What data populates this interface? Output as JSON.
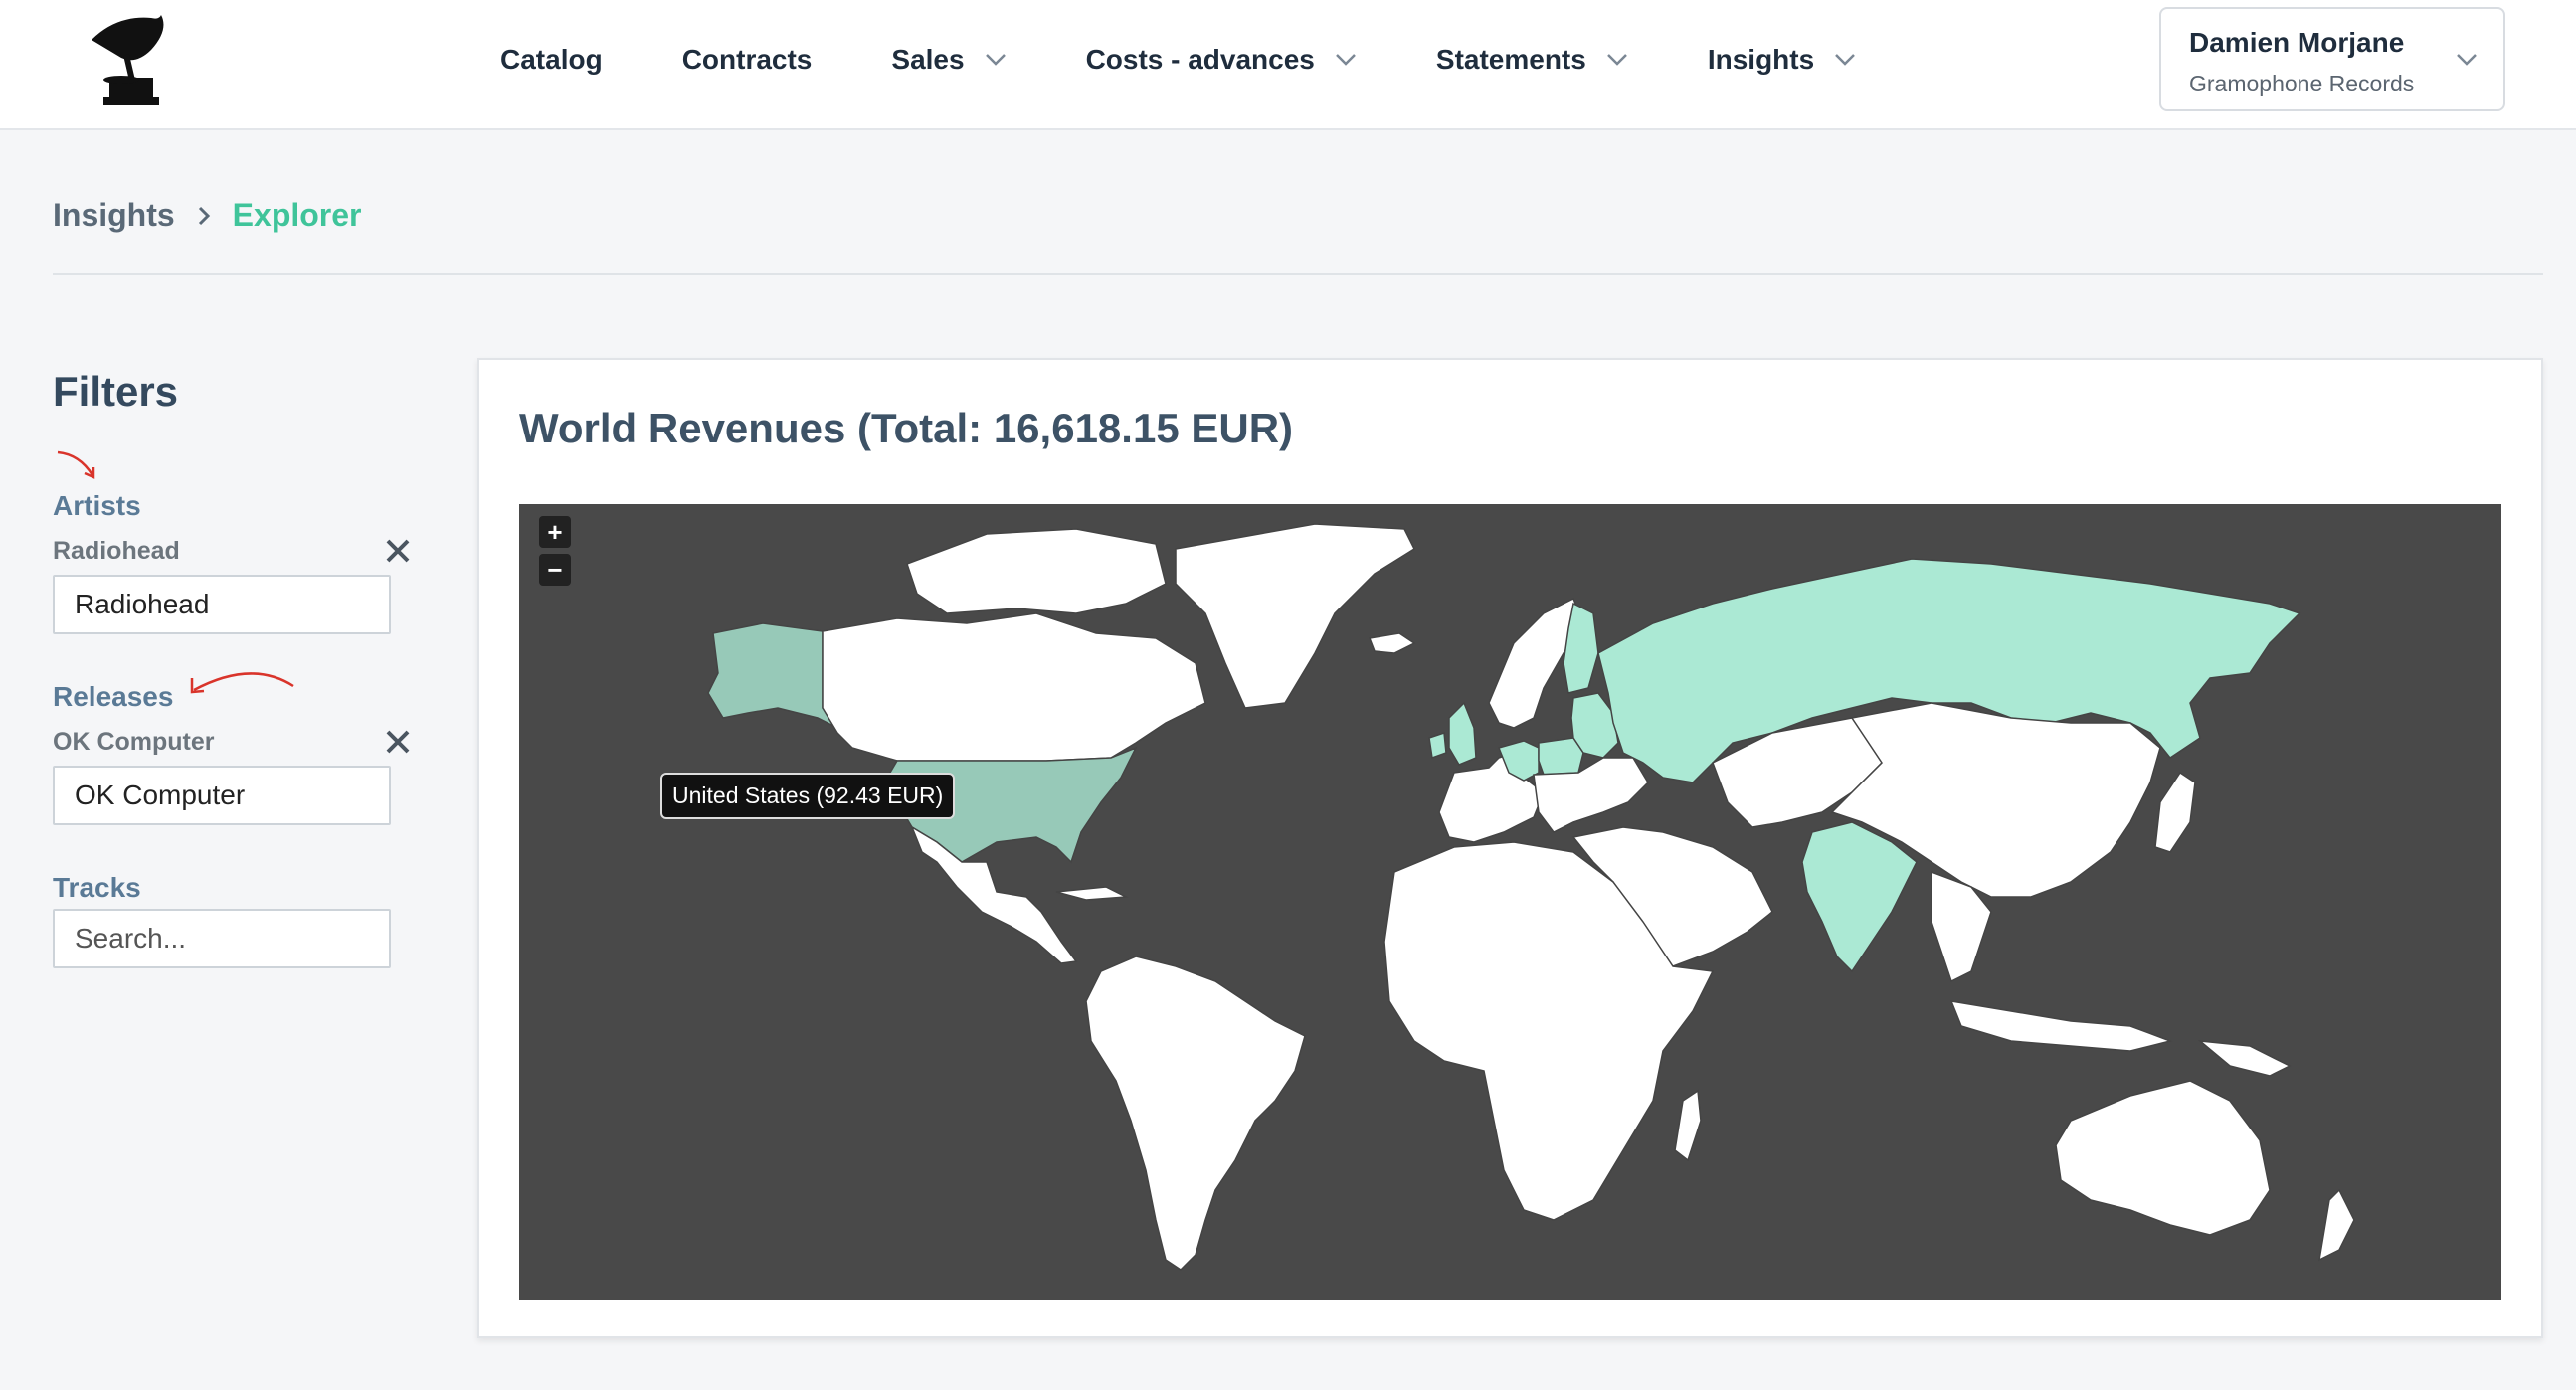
{
  "header": {
    "logo": "gramophone-logo",
    "nav": [
      {
        "label": "Catalog",
        "dropdown": false
      },
      {
        "label": "Contracts",
        "dropdown": false
      },
      {
        "label": "Sales",
        "dropdown": true
      },
      {
        "label": "Costs - advances",
        "dropdown": true
      },
      {
        "label": "Statements",
        "dropdown": true
      },
      {
        "label": "Insights",
        "dropdown": true
      }
    ],
    "user": {
      "name": "Damien Morjane",
      "org": "Gramophone Records"
    }
  },
  "breadcrumb": {
    "parent": "Insights",
    "current": "Explorer"
  },
  "filters": {
    "title": "Filters",
    "artists": {
      "label": "Artists",
      "selected": "Radiohead",
      "value": "Radiohead"
    },
    "releases": {
      "label": "Releases",
      "selected": "OK Computer",
      "value": "OK Computer"
    },
    "tracks": {
      "label": "Tracks",
      "placeholder": "Search..."
    }
  },
  "map_card": {
    "title": "World Revenues (Total: 16,618.15 EUR)",
    "zoom_in": "+",
    "zoom_out": "−",
    "tooltip": "United States (92.43 EUR)",
    "colors": {
      "ocean": "#494949",
      "no_revenue": "#ffffff",
      "revenue": "#abe9d4",
      "hovered": "#97c9b8",
      "accent": "#3fc49a"
    },
    "highlighted_countries": [
      "United States",
      "Alaska (United States)",
      "Russia",
      "India",
      "United Kingdom",
      "Ireland",
      "Germany",
      "Poland",
      "Belarus",
      "Latvia",
      "Lithuania",
      "Estonia",
      "Finland"
    ]
  }
}
